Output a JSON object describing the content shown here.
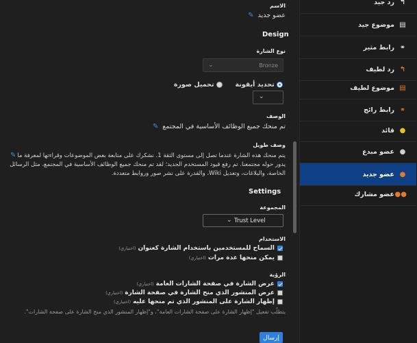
{
  "form": {
    "name_label": "الاسم",
    "name_value": "عضو جديد",
    "design_heading": "Design",
    "badge_type_label": "نوع الشارة",
    "badge_type_value": "Bronze",
    "icon_choice_label": "تحديد أيقونة",
    "image_choice_label": "تحميل صورة",
    "description_label": "الوصف",
    "description_value": "تم منحك جميع الوظائف الأساسية في المجتمع",
    "long_description_label": "وصف طويل",
    "long_description_value": "يتم منحك هذه الشارة عندما تصل إلى مستوى الثقة 1. نشكرك على متابعة بعض الموضوعات وقراءتها لمعرفة ما يدور حوله مجتمعنا. تم رفع قيود المستخدم الجديد؛ لقد تم منحك جميع الوظائف الأساسية في المجتمع، مثل الرسائل الخاصة، والبلاغات، وتعديل Wiki، والقدرة على نشر صور وروابط متعددة.",
    "settings_heading": "Settings",
    "group_label": "المجموعة",
    "group_value": "Trust Level",
    "usage_label": "الاستخدام",
    "usage_options": [
      {
        "label": "السماح للمستخدمين باستخدام الشارة كعنوان",
        "optional": "(اختياري)",
        "checked": true
      },
      {
        "label": "يمكن منحها عدة مرات",
        "optional": "(اختياري)",
        "checked": false
      }
    ],
    "visibility_label": "الرؤية",
    "visibility_options": [
      {
        "label": "عرض الشارة في صفحة الشارات العامة",
        "optional": "(اختياري)",
        "checked": true
      },
      {
        "label": "عرض المنشور الذي منح الشارة في صفحة الشارة",
        "optional": "(اختياري)",
        "checked": false
      },
      {
        "label": "إظهار الشارة على المنشور الذي تم منحها عليه",
        "optional": "(اختياري)",
        "checked": false
      }
    ],
    "visibility_note": "يتطلّب تفعيل \"إظهار الشارة على صفحة الشارات العامة\"، و\"إظهار المنشور الذي منح الشارة على صفحة الشارات\".",
    "submit_label": "إرسال"
  },
  "sidebar": {
    "items": [
      {
        "label": "رد جيد",
        "icon": "reply-icon",
        "glyph": "↰",
        "color": "#e6e6e6"
      },
      {
        "label": "موضوع جيد",
        "icon": "file-icon",
        "glyph": "▤",
        "color": "#e6e6e6"
      },
      {
        "label": "رابط مثير",
        "icon": "link-icon",
        "glyph": "⚭",
        "color": "#e6e6e6"
      },
      {
        "label": "رد لطيف",
        "icon": "reply-icon",
        "glyph": "↰",
        "color": "#e07a2f"
      },
      {
        "label": "موضوع لطيف",
        "icon": "file-icon",
        "glyph": "▤",
        "color": "#e07a2f"
      },
      {
        "label": "رابط رائج",
        "icon": "link-icon",
        "glyph": "⚭",
        "color": "#e07a2f"
      },
      {
        "label": "قائد",
        "icon": "user-icon",
        "glyph": "●",
        "color": "#e8c020"
      },
      {
        "label": "عضو مبدع",
        "icon": "user-icon",
        "glyph": "●",
        "color": "#cfcfcf"
      },
      {
        "label": "عضو جديد",
        "icon": "user-icon",
        "glyph": "●",
        "color": "#e07a2f"
      },
      {
        "label": "عضو مشارك",
        "icon": "users-icon",
        "glyph": "●●",
        "color": "#e07a2f"
      }
    ],
    "active_index": 8
  }
}
